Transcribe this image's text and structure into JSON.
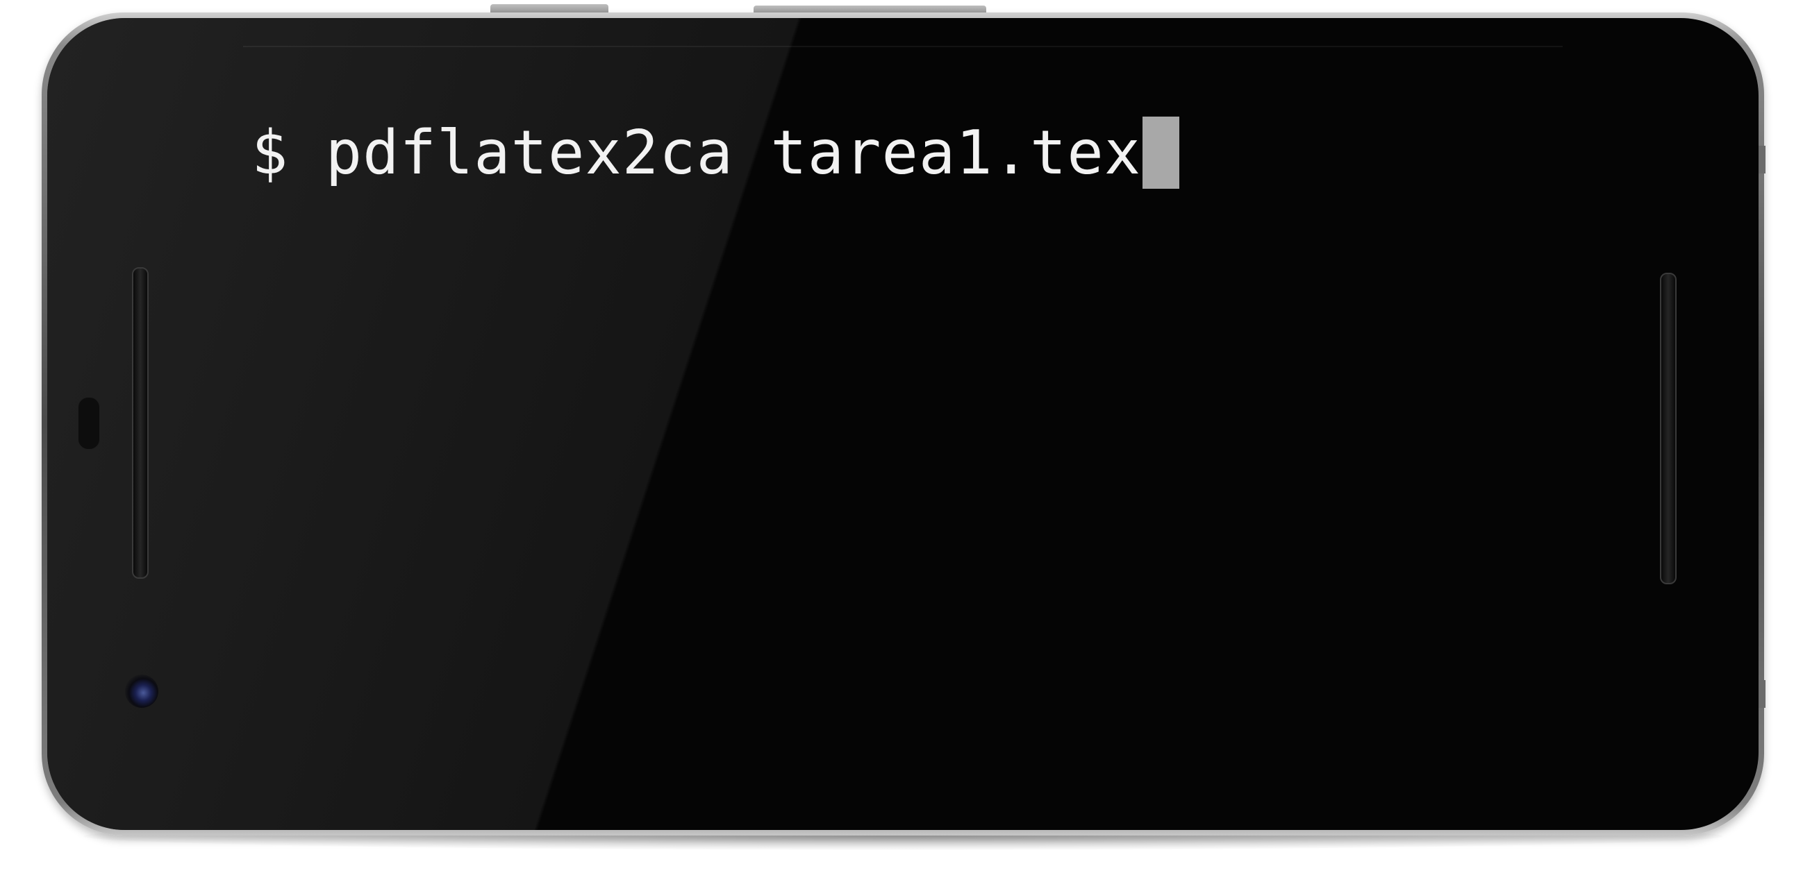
{
  "terminal": {
    "prompt": "$",
    "command": "pdflatex2ca tarea1.tex"
  },
  "colors": {
    "screen_background": "#000000",
    "text": "#f2f2f2",
    "cursor": "#a8a8a8"
  },
  "icons": [
    "front-camera-icon"
  ]
}
